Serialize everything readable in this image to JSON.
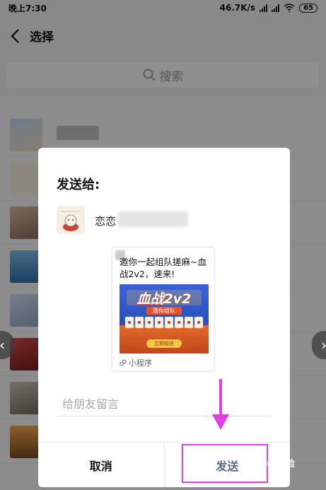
{
  "status_bar": {
    "time": "晚上7:30",
    "speed": "46.7K/s",
    "battery": "65"
  },
  "header": {
    "title": "选择"
  },
  "search": {
    "placeholder": "搜索"
  },
  "dialog": {
    "title": "发送给:",
    "recipient_name": "恋恋",
    "card": {
      "title": "邀你一起组队搓麻~血战2v2，速来!",
      "banner_title": "血战2v2",
      "banner_subtitle": "邀你组队",
      "banner_button": "立即前往",
      "footer_label": "小程序"
    },
    "message_placeholder": "给朋友留言",
    "cancel_label": "取消",
    "send_label": "发送"
  },
  "colors": {
    "send": "#576b95",
    "annotation": "#e040e0",
    "banner": "#2b53c9"
  },
  "watermark": "Bai du 经验"
}
